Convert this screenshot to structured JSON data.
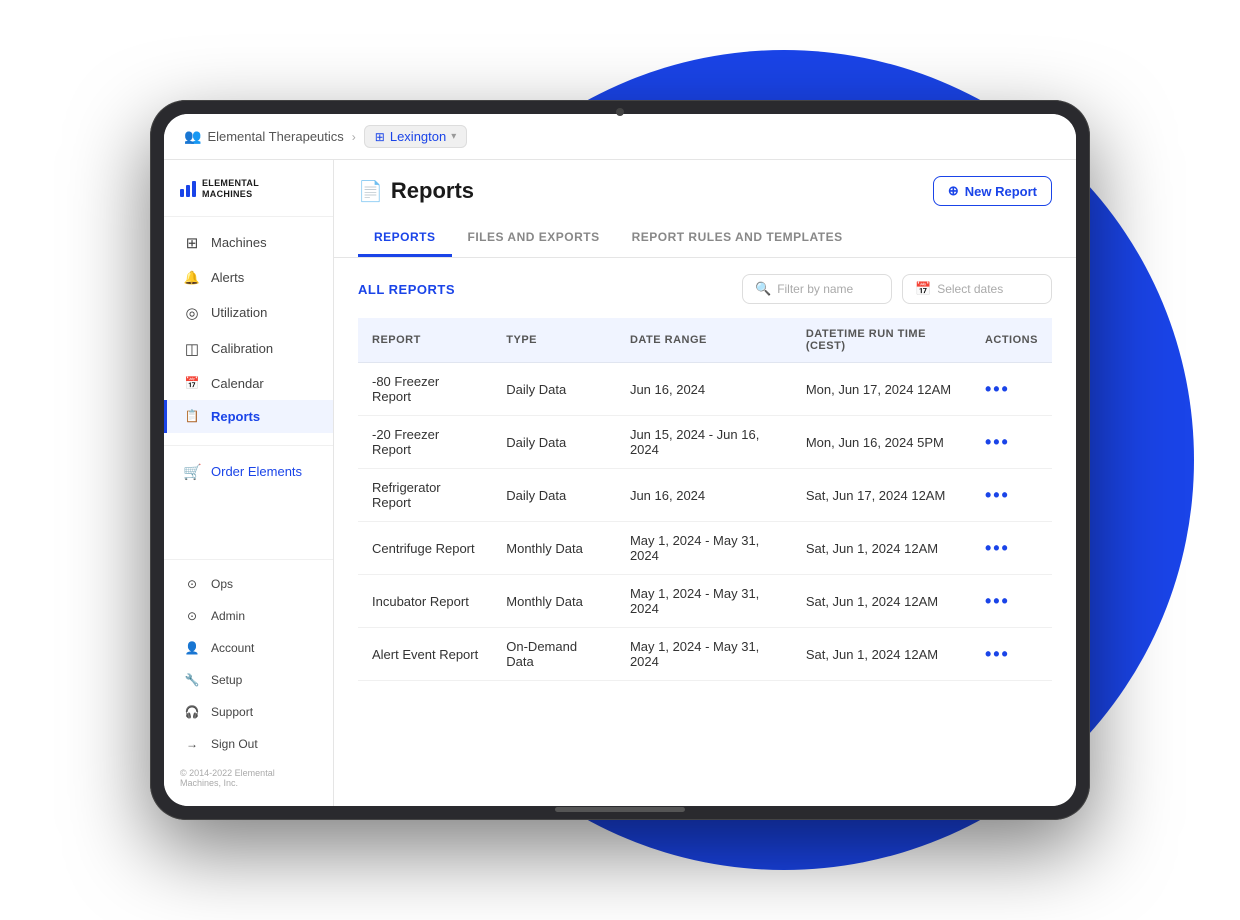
{
  "background": {
    "circle_color": "#1a44e8"
  },
  "topbar": {
    "org_name": "Elemental Therapeutics",
    "location": "Lexington",
    "chevron": "▾"
  },
  "sidebar": {
    "logo_text_line1": "ELEMENTAL",
    "logo_text_line2": "MACHINES",
    "nav_items": [
      {
        "id": "machines",
        "label": "Machines",
        "icon": "⊞"
      },
      {
        "id": "alerts",
        "label": "Alerts",
        "icon": "🔔"
      },
      {
        "id": "utilization",
        "label": "Utilization",
        "icon": "◎"
      },
      {
        "id": "calibration",
        "label": "Calibration",
        "icon": "◫"
      },
      {
        "id": "calendar",
        "label": "Calendar",
        "icon": "📅"
      },
      {
        "id": "reports",
        "label": "Reports",
        "icon": "📋",
        "active": true
      }
    ],
    "secondary_items": [
      {
        "id": "order-elements",
        "label": "Order Elements",
        "icon": "🛒"
      }
    ],
    "bottom_items": [
      {
        "id": "ops",
        "label": "Ops",
        "icon": "⊙"
      },
      {
        "id": "admin",
        "label": "Admin",
        "icon": "⊙"
      },
      {
        "id": "account",
        "label": "Account",
        "icon": "👤"
      },
      {
        "id": "setup",
        "label": "Setup",
        "icon": "🔧"
      },
      {
        "id": "support",
        "label": "Support",
        "icon": "🎧"
      },
      {
        "id": "sign-out",
        "label": "Sign Out",
        "icon": "→"
      }
    ],
    "footer_text": "© 2014-2022 Elemental Machines, Inc."
  },
  "page": {
    "title": "Reports",
    "title_icon": "📄",
    "new_report_button": "New Report",
    "new_report_icon": "⊕"
  },
  "tabs": [
    {
      "id": "reports",
      "label": "Reports",
      "active": true
    },
    {
      "id": "files-exports",
      "label": "Files and Exports",
      "active": false
    },
    {
      "id": "rules-templates",
      "label": "Report Rules and Templates",
      "active": false
    }
  ],
  "filter": {
    "label": "All Reports",
    "search_placeholder": "Filter by name",
    "date_placeholder": "Select dates",
    "search_icon": "🔍",
    "calendar_icon": "📅"
  },
  "table": {
    "columns": [
      {
        "id": "report",
        "label": "Report"
      },
      {
        "id": "type",
        "label": "Type"
      },
      {
        "id": "date_range",
        "label": "Date Range"
      },
      {
        "id": "datetime_run",
        "label": "Datetime Run Time (CEST)"
      },
      {
        "id": "actions",
        "label": "Actions"
      }
    ],
    "rows": [
      {
        "report": "-80 Freezer Report",
        "type": "Daily Data",
        "date_range": "Jun 16, 2024",
        "datetime_run": "Mon, Jun 17, 2024 12AM"
      },
      {
        "report": "-20 Freezer Report",
        "type": "Daily Data",
        "date_range": "Jun 15, 2024 - Jun 16, 2024",
        "datetime_run": "Mon, Jun 16, 2024 5PM"
      },
      {
        "report": "Refrigerator Report",
        "type": "Daily Data",
        "date_range": "Jun 16, 2024",
        "datetime_run": "Sat, Jun 17, 2024 12AM"
      },
      {
        "report": "Centrifuge Report",
        "type": "Monthly Data",
        "date_range": "May 1, 2024 - May 31, 2024",
        "datetime_run": "Sat, Jun 1, 2024 12AM"
      },
      {
        "report": "Incubator Report",
        "type": "Monthly Data",
        "date_range": "May 1, 2024 - May 31, 2024",
        "datetime_run": "Sat, Jun 1, 2024 12AM"
      },
      {
        "report": "Alert Event Report",
        "type": "On-Demand Data",
        "date_range": "May 1, 2024 - May 31, 2024",
        "datetime_run": "Sat, Jun 1, 2024 12AM"
      }
    ],
    "actions_dots": "•••"
  }
}
